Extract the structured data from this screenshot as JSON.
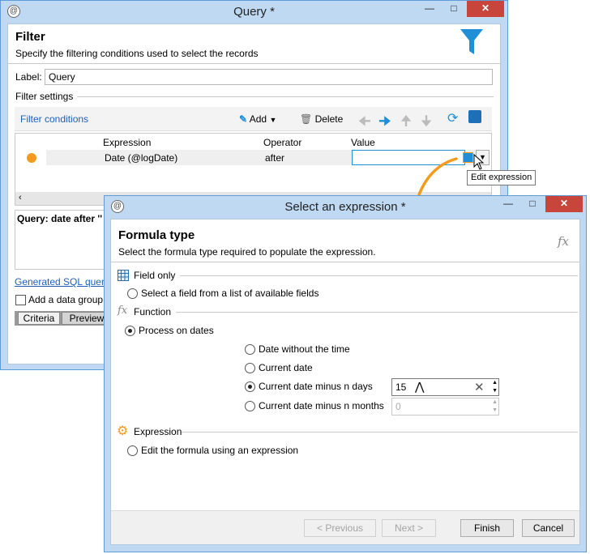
{
  "query_window": {
    "title": "Query *",
    "header": {
      "title": "Filter",
      "subtitle": "Specify the filtering conditions used to select the records"
    },
    "label_caption": "Label:",
    "label_value": "Query",
    "section": "Filter settings",
    "filter_tab": "Filter conditions",
    "toolbar": {
      "add": "Add",
      "delete": "Delete"
    },
    "columns": [
      "Expression",
      "Operator",
      "Value"
    ],
    "row": {
      "expression": "Date (@logDate)",
      "operator": "after",
      "value": ""
    },
    "tooltip": "Edit expression",
    "query_text": "Query: date after ''",
    "sql_link": "Generated SQL query",
    "group_checkbox": "Add a data group",
    "tabs": [
      "Criteria",
      "Preview"
    ]
  },
  "expr_window": {
    "title": "Select an expression *",
    "header": {
      "title": "Formula type",
      "subtitle": "Select the formula type required to populate the expression."
    },
    "fx": "fx",
    "field_only": {
      "heading": "Field only",
      "option": "Select a field from a list of available fields"
    },
    "function": {
      "heading": "Function",
      "option": "Process on dates",
      "sub_options": [
        "Date without the time",
        "Current date",
        "Current date minus n days",
        "Current date minus n months"
      ],
      "days_value": "15",
      "months_value": "0"
    },
    "expression": {
      "heading": "Expression",
      "option": "Edit the formula using an expression"
    },
    "buttons": {
      "previous": "< Previous",
      "next": "Next >",
      "finish": "Finish",
      "cancel": "Cancel"
    }
  },
  "colors": {
    "accent": "#1f8fd8",
    "orange": "#f29b1c",
    "close": "#c7453b"
  }
}
